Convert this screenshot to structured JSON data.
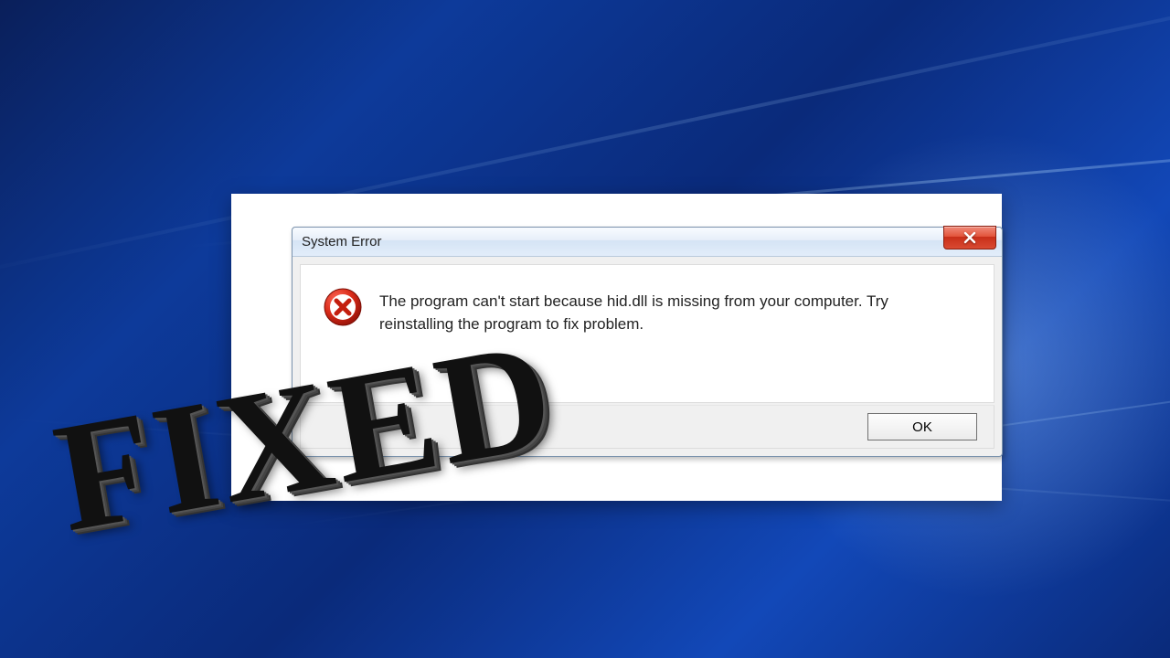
{
  "dialog": {
    "title": "System Error",
    "message": "The program can't start because hid.dll is missing from your computer. Try reinstalling the program to fix problem.",
    "ok_label": "OK"
  },
  "overlay": {
    "stamp_text": "FIXED"
  }
}
